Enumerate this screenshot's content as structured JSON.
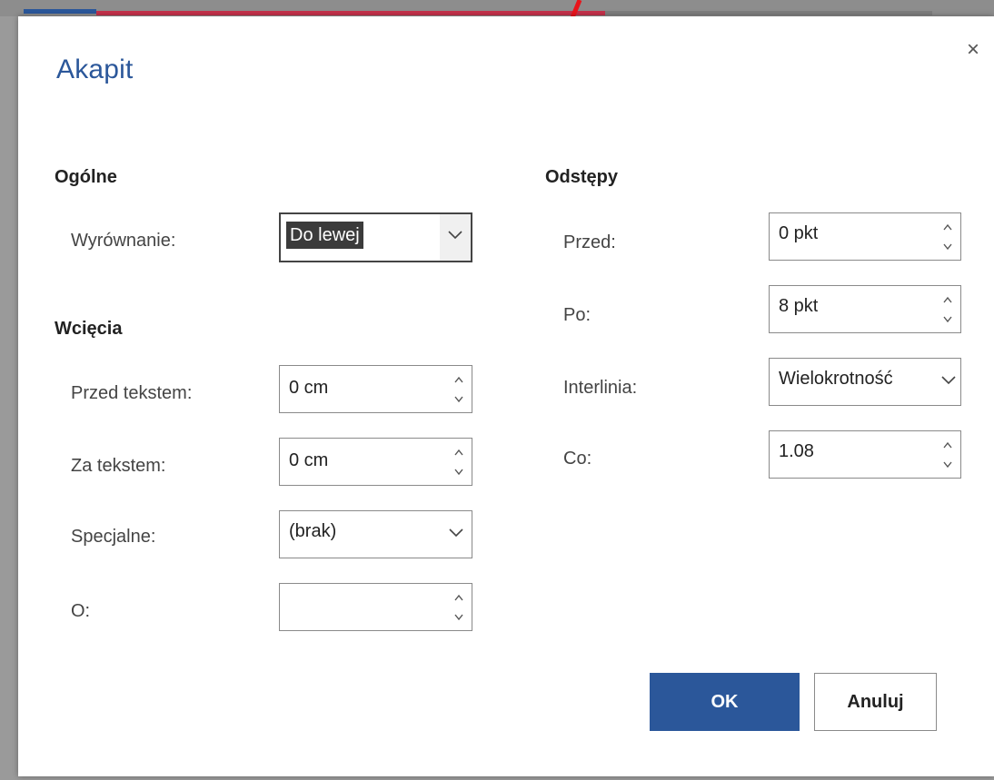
{
  "dialog": {
    "title": "Akapit",
    "close_glyph": "×"
  },
  "general": {
    "section_title": "Ogólne",
    "alignment_label": "Wyrównanie:",
    "alignment_value": "Do lewej"
  },
  "indent": {
    "section_title": "Wcięcia",
    "before_label": "Przed tekstem:",
    "before_value": "0 cm",
    "after_label": "Za tekstem:",
    "after_value": "0 cm",
    "special_label": "Specjalne:",
    "special_value": "(brak)",
    "by_label": "O:",
    "by_value": ""
  },
  "spacing": {
    "section_title": "Odstępy",
    "before_label": "Przed:",
    "before_value": "0 pkt",
    "after_label": "Po:",
    "after_value": "8 pkt",
    "line_spacing_label": "Interlinia:",
    "line_spacing_value": "Wielokrotność",
    "at_label": "Co:",
    "at_value": "1.08"
  },
  "buttons": {
    "ok_label": "OK",
    "cancel_label": "Anuluj"
  },
  "colors": {
    "accent": "#2b579a",
    "annotation_arrow": "#e8141b"
  },
  "icons": {
    "close": "close-icon",
    "chevron": "chevron-down-icon",
    "spin_up": "chevron-up-icon",
    "spin_down": "chevron-down-icon",
    "annotation": "arrow-icon"
  }
}
